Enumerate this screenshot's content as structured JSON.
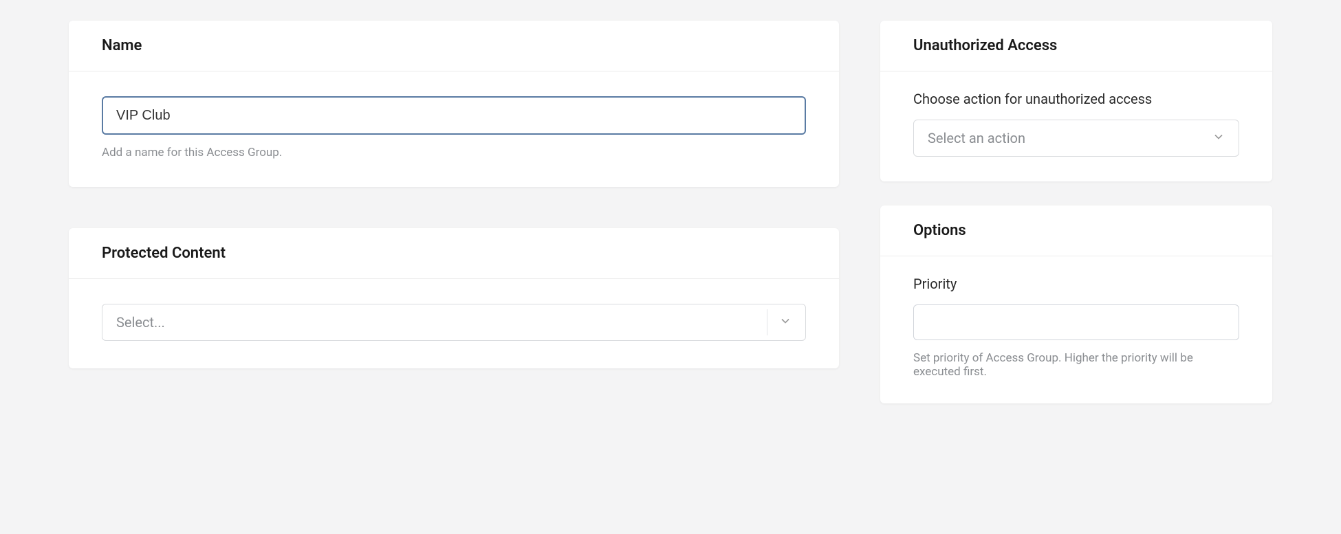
{
  "name_card": {
    "title": "Name",
    "value": "VIP Club",
    "helper": "Add a name for this Access Group."
  },
  "protected_content_card": {
    "title": "Protected Content",
    "placeholder": "Select..."
  },
  "unauthorized_card": {
    "title": "Unauthorized Access",
    "label": "Choose action for unauthorized access",
    "placeholder": "Select an action"
  },
  "options_card": {
    "title": "Options",
    "priority_label": "Priority",
    "priority_value": "",
    "helper": "Set priority of Access Group. Higher the priority will be executed first."
  }
}
